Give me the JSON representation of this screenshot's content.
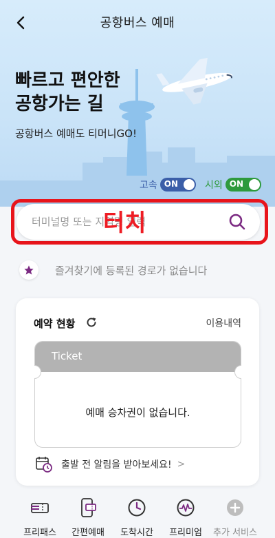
{
  "header": {
    "title": "공항버스 예매"
  },
  "hero": {
    "headline_line1": "빠르고 편안한",
    "headline_line2": "공항가는 길",
    "subline": "공항버스 예매도 티머니GO!"
  },
  "toggles": [
    {
      "label": "고속",
      "state": "ON",
      "color": "#3b5ea8"
    },
    {
      "label": "시외",
      "state": "ON",
      "color": "#2e9a3c"
    }
  ],
  "search": {
    "placeholder": "터미널명 또는 지역명 입력",
    "overlay_text": "터치",
    "outline_color": "#e8141b"
  },
  "favorites": {
    "empty_text": "즐겨찾기에 등록된 경로가 없습니다"
  },
  "reservation": {
    "title": "예약 현황",
    "history_link": "이용내역",
    "ticket_label": "Ticket",
    "empty_text": "예매 승차권이 없습니다.",
    "alert_text": "출발 전 알림을 받아보세요!",
    "alert_chevron": ">"
  },
  "bottom_nav": [
    {
      "label": "프리패스",
      "icon": "freepass-ticket-icon"
    },
    {
      "label": "간편예매",
      "icon": "phone-ticket-icon"
    },
    {
      "label": "도착시간",
      "icon": "clock-icon"
    },
    {
      "label": "프리미엄",
      "icon": "pulse-icon"
    },
    {
      "label": "추가 서비스",
      "icon": "plus-circle-icon"
    }
  ],
  "colors": {
    "accent": "#7b2a82",
    "alert_red": "#ee1c24"
  }
}
